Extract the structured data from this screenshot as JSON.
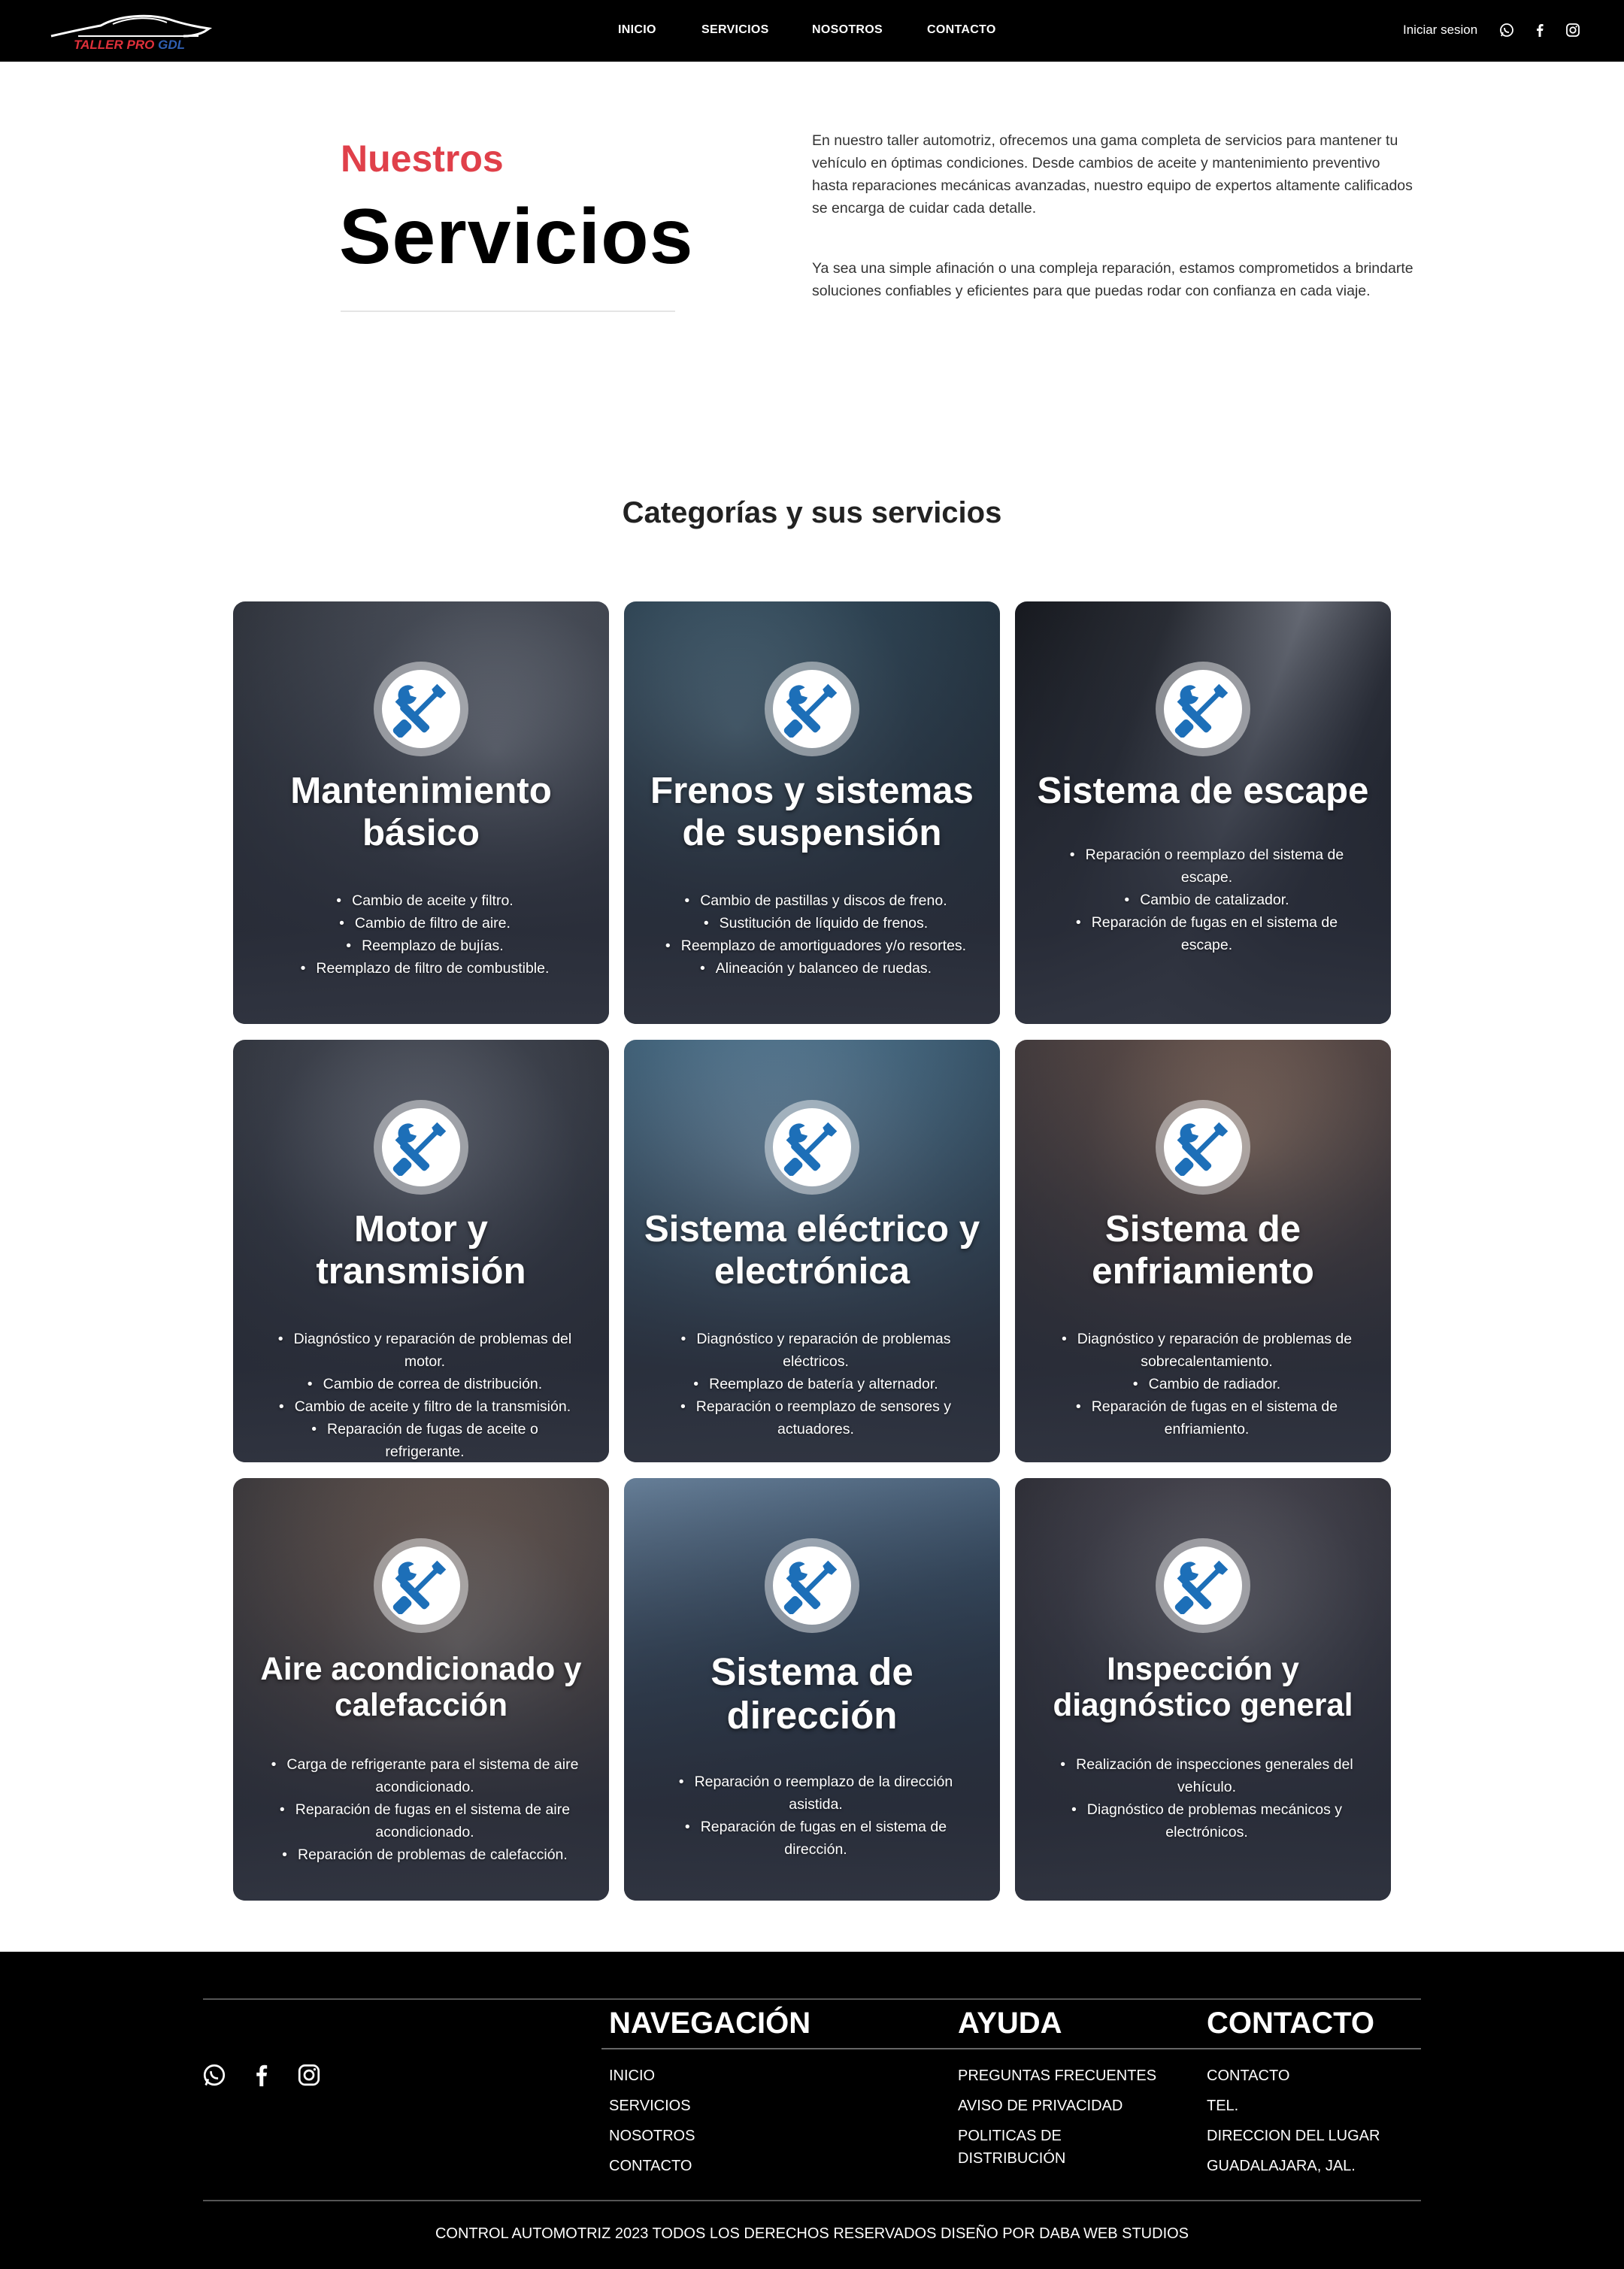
{
  "header": {
    "logo": {
      "text_red": "TALLER PRO",
      "text_blue": "GDL"
    },
    "nav": [
      "INICIO",
      "SERVICIOS",
      "NOSOTROS",
      "CONTACTO"
    ],
    "login_label": "Iniciar sesion",
    "social_icons": [
      "whatsapp-icon",
      "facebook-icon",
      "instagram-icon"
    ]
  },
  "intro": {
    "subtitle": "Nuestros",
    "title": "Servicios",
    "paragraph_1": "En nuestro taller automotriz, ofrecemos una gama completa de servicios para mantener tu vehículo en óptimas condiciones. Desde cambios de aceite y mantenimiento preventivo hasta reparaciones mecánicas avanzadas, nuestro equipo de expertos altamente calificados se encarga de cuidar cada detalle.",
    "paragraph_2": "Ya sea una simple afinación o una compleja reparación, estamos comprometidos a brindarte soluciones confiables y eficientes para que puedas rodar con confianza en cada viaje."
  },
  "categories": {
    "heading": "Categorías y sus servicios",
    "cards": [
      {
        "title_lines": [
          "Mantenimiento",
          "básico"
        ],
        "items": [
          "Cambio de aceite y filtro.",
          "Cambio de filtro de aire.",
          "Reemplazo de bujías.",
          "Reemplazo de filtro de combustible."
        ]
      },
      {
        "title_lines": [
          "Frenos y sistemas",
          "de suspensión"
        ],
        "items": [
          "Cambio de pastillas y discos de freno.",
          "Sustitución de líquido de frenos.",
          "Reemplazo de amortiguadores y/o resortes.",
          "Alineación y balanceo de ruedas."
        ]
      },
      {
        "title_lines": [
          "Sistema de escape"
        ],
        "items": [
          "Reparación o reemplazo del sistema de escape.",
          "Cambio de catalizador.",
          "Reparación de fugas en el sistema de escape."
        ]
      },
      {
        "title_lines": [
          "Motor y",
          "transmisión"
        ],
        "items": [
          "Diagnóstico y reparación de problemas del motor.",
          "Cambio de correa de distribución.",
          "Cambio de aceite y filtro de la transmisión.",
          "Reparación de fugas de aceite o refrigerante."
        ]
      },
      {
        "title_lines": [
          "Sistema eléctrico y",
          "electrónica"
        ],
        "items": [
          "Diagnóstico y reparación de problemas eléctricos.",
          "Reemplazo de batería y alternador.",
          "Reparación o reemplazo de sensores y actuadores."
        ]
      },
      {
        "title_lines": [
          "Sistema de",
          "enfriamiento"
        ],
        "items": [
          "Diagnóstico y reparación de problemas de sobrecalentamiento.",
          "Cambio de radiador.",
          "Reparación de fugas en el sistema de enfriamiento."
        ]
      },
      {
        "title_lines": [
          "Aire acondicionado y",
          "calefacción"
        ],
        "items": [
          "Carga de refrigerante para el sistema de aire acondicionado.",
          "Reparación de fugas en el sistema de aire acondicionado.",
          "Reparación de problemas de calefacción."
        ]
      },
      {
        "title_lines": [
          "Sistema de",
          "dirección"
        ],
        "items": [
          "Reparación o reemplazo de la dirección asistida.",
          "Reparación de fugas en el sistema de dirección."
        ]
      },
      {
        "title_lines": [
          "Inspección y",
          "diagnóstico general"
        ],
        "items": [
          "Realización de inspecciones generales del vehículo.",
          "Diagnóstico de problemas mecánicos y electrónicos."
        ]
      }
    ]
  },
  "footer": {
    "social_icons": [
      "whatsapp-icon",
      "facebook-icon",
      "instagram-icon"
    ],
    "navegacion": {
      "heading": "NAVEGACIÓN",
      "links": [
        "INICIO",
        "SERVICIOS",
        "NOSOTROS",
        "CONTACTO"
      ]
    },
    "ayuda": {
      "heading": "AYUDA",
      "links": [
        "PREGUNTAS FRECUENTES",
        "AVISO DE PRIVACIDAD",
        "POLITICAS DE",
        "DISTRIBUCIÓN"
      ]
    },
    "contacto": {
      "heading": "CONTACTO",
      "links": [
        "CONTACTO",
        "TEL.",
        "DIRECCION DEL LUGAR",
        "GUADALAJARA, JAL."
      ]
    },
    "copyright": "CONTROL AUTOMOTRIZ 2023 TODOS LOS DERECHOS RESERVADOS DISEÑO POR DABA WEB STUDIOS"
  },
  "colors": {
    "accent_red": "#e0404a",
    "icon_blue": "#1d6fb8",
    "header_bg": "#000000",
    "card_overlay": "#2c3040"
  }
}
